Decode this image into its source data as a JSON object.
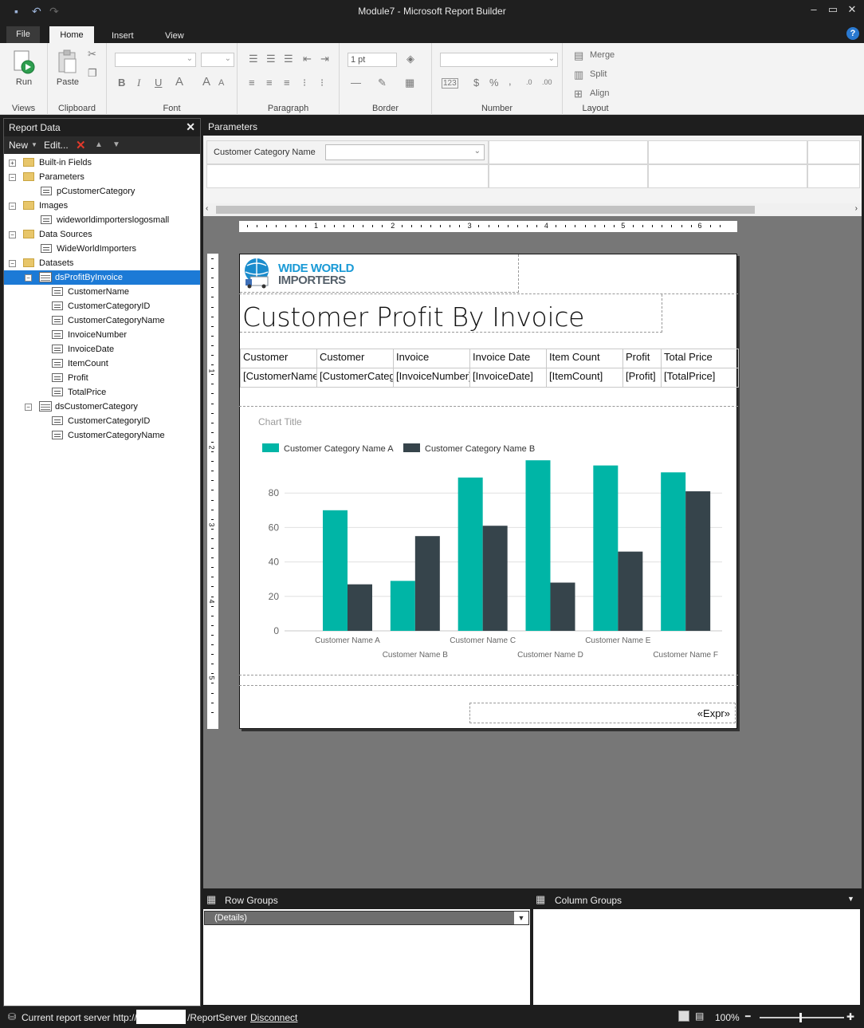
{
  "window": {
    "title": "Module7 - Microsoft Report Builder",
    "minimize": "–",
    "maximize": "▭",
    "close": "✕"
  },
  "tabs": [
    {
      "label": "File"
    },
    {
      "label": "Home"
    },
    {
      "label": "Insert"
    },
    {
      "label": "View"
    }
  ],
  "help": "?",
  "ribbon": {
    "views": {
      "label": "Views",
      "run": "Run"
    },
    "clipboard": {
      "label": "Clipboard",
      "paste": "Paste"
    },
    "font": {
      "label": "Font",
      "bold": "B",
      "italic": "I",
      "underline": "U",
      "color": "A",
      "grow": "A"
    },
    "paragraph": {
      "label": "Paragraph"
    },
    "border": {
      "label": "Border",
      "width": "1 pt"
    },
    "number": {
      "label": "Number",
      "placeholder": "123",
      "currency": "$",
      "percent": "%",
      "comma": ",",
      "inc": ".0",
      "dec": ".00"
    },
    "layout": {
      "label": "Layout",
      "merge": "Merge",
      "split": "Split",
      "align": "Align"
    }
  },
  "report_data": {
    "title": "Report Data",
    "close": "✕",
    "new": "New",
    "edit": "Edit...",
    "delete": "✕",
    "up": "▲",
    "down": "▼",
    "tree": [
      {
        "label": "Built-in Fields",
        "kind": "folder",
        "exp": "+"
      },
      {
        "label": "Parameters",
        "kind": "folder",
        "exp": "−"
      },
      {
        "label": "pCustomerCategory",
        "kind": "param"
      },
      {
        "label": "Images",
        "kind": "folder",
        "exp": "−"
      },
      {
        "label": "wideworldimporterslogosmall",
        "kind": "image"
      },
      {
        "label": "Data Sources",
        "kind": "folder",
        "exp": "−"
      },
      {
        "label": "WideWorldImporters",
        "kind": "source"
      },
      {
        "label": "Datasets",
        "kind": "folder",
        "exp": "−"
      },
      {
        "label": "dsProfitByInvoice",
        "kind": "dataset",
        "exp": "−",
        "selected": true
      },
      {
        "label": "CustomerName",
        "kind": "field"
      },
      {
        "label": "CustomerCategoryID",
        "kind": "field"
      },
      {
        "label": "CustomerCategoryName",
        "kind": "field"
      },
      {
        "label": "InvoiceNumber",
        "kind": "field"
      },
      {
        "label": "InvoiceDate",
        "kind": "field"
      },
      {
        "label": "ItemCount",
        "kind": "field"
      },
      {
        "label": "Profit",
        "kind": "field"
      },
      {
        "label": "TotalPrice",
        "kind": "field"
      },
      {
        "label": "dsCustomerCategory",
        "kind": "dataset",
        "exp": "−"
      },
      {
        "label": "CustomerCategoryID",
        "kind": "field"
      },
      {
        "label": "CustomerCategoryName",
        "kind": "field"
      }
    ]
  },
  "parameters": {
    "title": "Parameters",
    "label": "Customer Category Name",
    "value": ""
  },
  "ruler": {
    "top": [
      "1",
      "2",
      "3",
      "4",
      "5",
      "6"
    ],
    "left": [
      "1",
      "2",
      "3",
      "4",
      "5"
    ]
  },
  "report": {
    "logo_line1": "WIDE WORLD",
    "logo_line2": "IMPORTERS",
    "title": "Customer Profit By Invoice",
    "headers": [
      "Customer",
      "Customer",
      "Invoice",
      "Invoice Date",
      "Item Count",
      "Profit",
      "Total Price"
    ],
    "row": [
      "[CustomerName]",
      "[CustomerCateg",
      "[InvoiceNumber]",
      "[InvoiceDate]",
      "[ItemCount]",
      "[Profit]",
      "[TotalPrice]"
    ],
    "footer_expr": "«Expr»"
  },
  "chart_data": {
    "type": "bar",
    "title": "Chart Title",
    "categories": [
      "Customer Name A",
      "Customer Name B",
      "Customer Name C",
      "Customer Name D",
      "Customer Name E",
      "Customer Name F"
    ],
    "series": [
      {
        "name": "Customer Category Name A",
        "color": "#00b5a6",
        "values": [
          70,
          29,
          89,
          99,
          96,
          92
        ]
      },
      {
        "name": "Customer Category Name B",
        "color": "#36444b",
        "values": [
          27,
          55,
          61,
          28,
          46,
          81
        ]
      }
    ],
    "ylim": [
      0,
      100
    ],
    "yticks": [
      0,
      20,
      40,
      60,
      80
    ],
    "grid": true,
    "legend": "top-left"
  },
  "groups": {
    "row_title": "Row Groups",
    "col_title": "Column Groups",
    "row_item": "(Details)"
  },
  "status": {
    "server_prefix": "Current report server http://",
    "server_suffix": "/ReportServer",
    "disconnect": "Disconnect",
    "zoom": "100%",
    "minus": "━",
    "plus": "✚"
  }
}
